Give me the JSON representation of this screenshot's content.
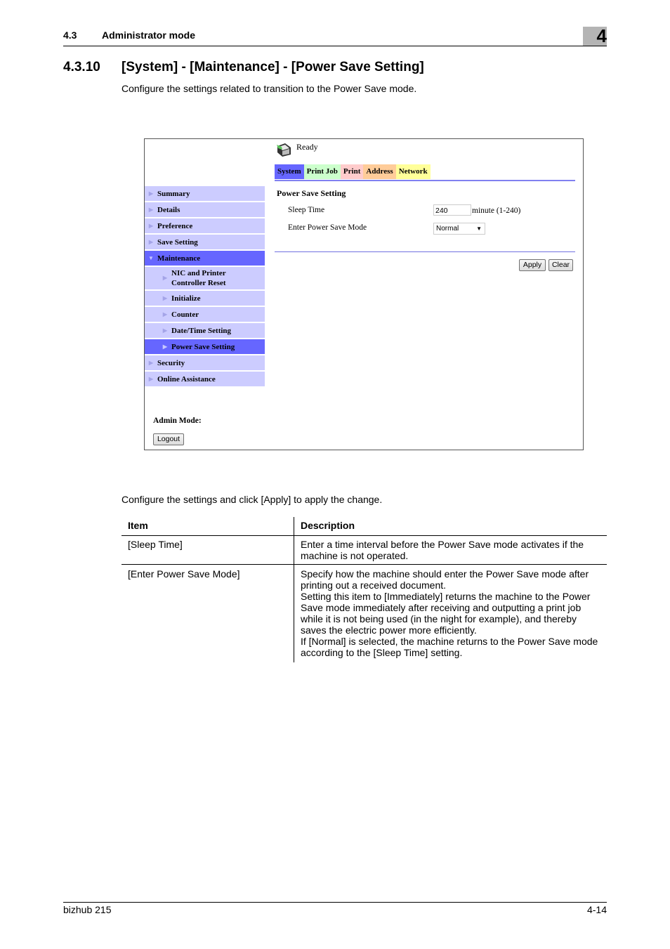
{
  "header": {
    "section_number": "4.3",
    "section_title": "Administrator mode",
    "chapter_number": "4"
  },
  "section": {
    "number": "4.3.10",
    "title": "[System] - [Maintenance] - [Power Save Setting]",
    "intro": "Configure the settings related to transition to the Power Save mode."
  },
  "screenshot": {
    "status": "Ready",
    "status_icon": "printer-icon",
    "tabs": [
      {
        "label": "System",
        "color": "#6666ff"
      },
      {
        "label": "Print Job",
        "color": "#ccffcc"
      },
      {
        "label": "Print",
        "color": "#ffcccc"
      },
      {
        "label": "Address",
        "color": "#ffcc99"
      },
      {
        "label": "Network",
        "color": "#ffff99"
      }
    ],
    "sidebar": [
      {
        "label": "Summary"
      },
      {
        "label": "Details"
      },
      {
        "label": "Preference"
      },
      {
        "label": "Save Setting"
      },
      {
        "label": "Maintenance",
        "expanded": true
      },
      {
        "label": "NIC and Printer Controller Reset",
        "sub": true
      },
      {
        "label": "Initialize",
        "sub": true
      },
      {
        "label": "Counter",
        "sub": true
      },
      {
        "label": "Date/Time Setting",
        "sub": true
      },
      {
        "label": "Power Save Setting",
        "sub": true,
        "selected": true
      },
      {
        "label": "Security"
      },
      {
        "label": "Online Assistance"
      }
    ],
    "panel_title": "Power Save Setting",
    "sleep_time_label": "Sleep Time",
    "sleep_time_value": "240",
    "sleep_time_unit": "minute (1-240)",
    "mode_label": "Enter Power Save Mode",
    "mode_value": "Normal",
    "apply_label": "Apply",
    "clear_label": "Clear",
    "admin_mode_label": "Admin Mode:",
    "logout_label": "Logout"
  },
  "body": {
    "configure_text": "Configure the settings and click [Apply] to apply the change."
  },
  "table": {
    "headers": [
      "Item",
      "Description"
    ],
    "rows": [
      {
        "item": "[Sleep Time]",
        "description": [
          "Enter a time interval before the Power Save mode activates if the machine is not operated."
        ]
      },
      {
        "item": "[Enter Power Save Mode]",
        "description": [
          "Specify how the machine should enter the Power Save mode after printing out a received document.",
          "Setting this item to [Immediately] returns the machine to the Power Save mode immediately after receiving and outputting a print job while it is not being used (in the night for example), and thereby saves the electric power more efficiently.",
          "If [Normal] is selected, the machine returns to the Power Save mode according to the [Sleep Time] setting."
        ]
      }
    ]
  },
  "footer": {
    "product": "bizhub 215",
    "page": "4-14"
  }
}
